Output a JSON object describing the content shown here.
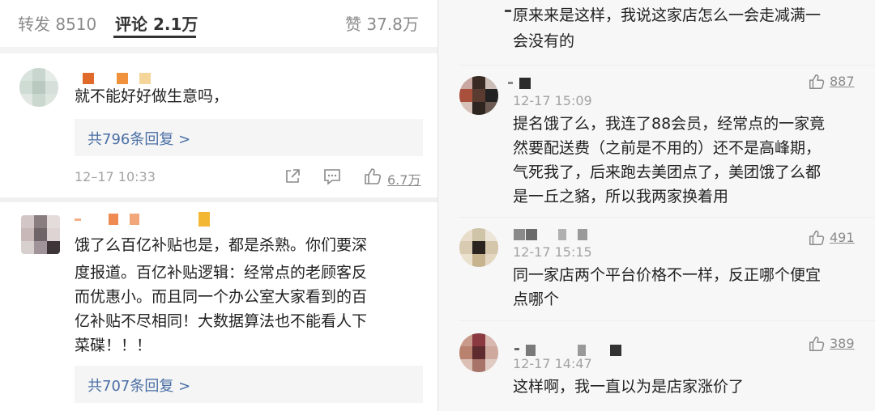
{
  "tabs": {
    "repost": "转发 8510",
    "comments": "评论 2.1万",
    "likes": "赞 37.8万"
  },
  "left_comments": [
    {
      "text_lines": [
        "就不能好好做生意吗，"
      ],
      "reply_link": "共796条回复 >",
      "time": "12–17 10:33",
      "likes": "6.7万"
    },
    {
      "text_lines": [
        "饿了么百亿补贴也是，都是杀熟。你们要深",
        "度报道。百亿补贴逻辑：经常点的老顾客反",
        "而优惠小。而且同一个办公室大家看到的百",
        "亿补贴不尽相同！大数据算法也不能看人下",
        "菜碟！！！"
      ],
      "reply_link": "共707条回复 >"
    }
  ],
  "right_top_reply": {
    "text_lines": [
      "原来来是这样，我说这家店怎么一会走减满一",
      "会没有的"
    ]
  },
  "right_comments": [
    {
      "time": "12-17 15:09",
      "likes": "887",
      "text_lines": [
        "提名饿了么，我连了88会员，经常点的一家竟",
        "然要配送费（之前是不用的）还不是高峰期，",
        "气死我了，后来跑去美团点了，美团饿了么都",
        "是一丘之貉，所以我两家换着用"
      ]
    },
    {
      "time": "12-17 15:15",
      "likes": "491",
      "text_lines": [
        "同一家店两个平台价格不一样，反正哪个便宜",
        "点哪个"
      ]
    },
    {
      "time": "12-17 14:47",
      "likes": "389",
      "text_lines": [
        "这样啊，我一直以为是店家涨价了"
      ]
    }
  ],
  "colors": {
    "link": "#4a6fa5",
    "meta": "#a3a3a3",
    "text": "#222222"
  },
  "icons": [
    "share-icon",
    "comment-icon",
    "thumbs-up-icon"
  ]
}
